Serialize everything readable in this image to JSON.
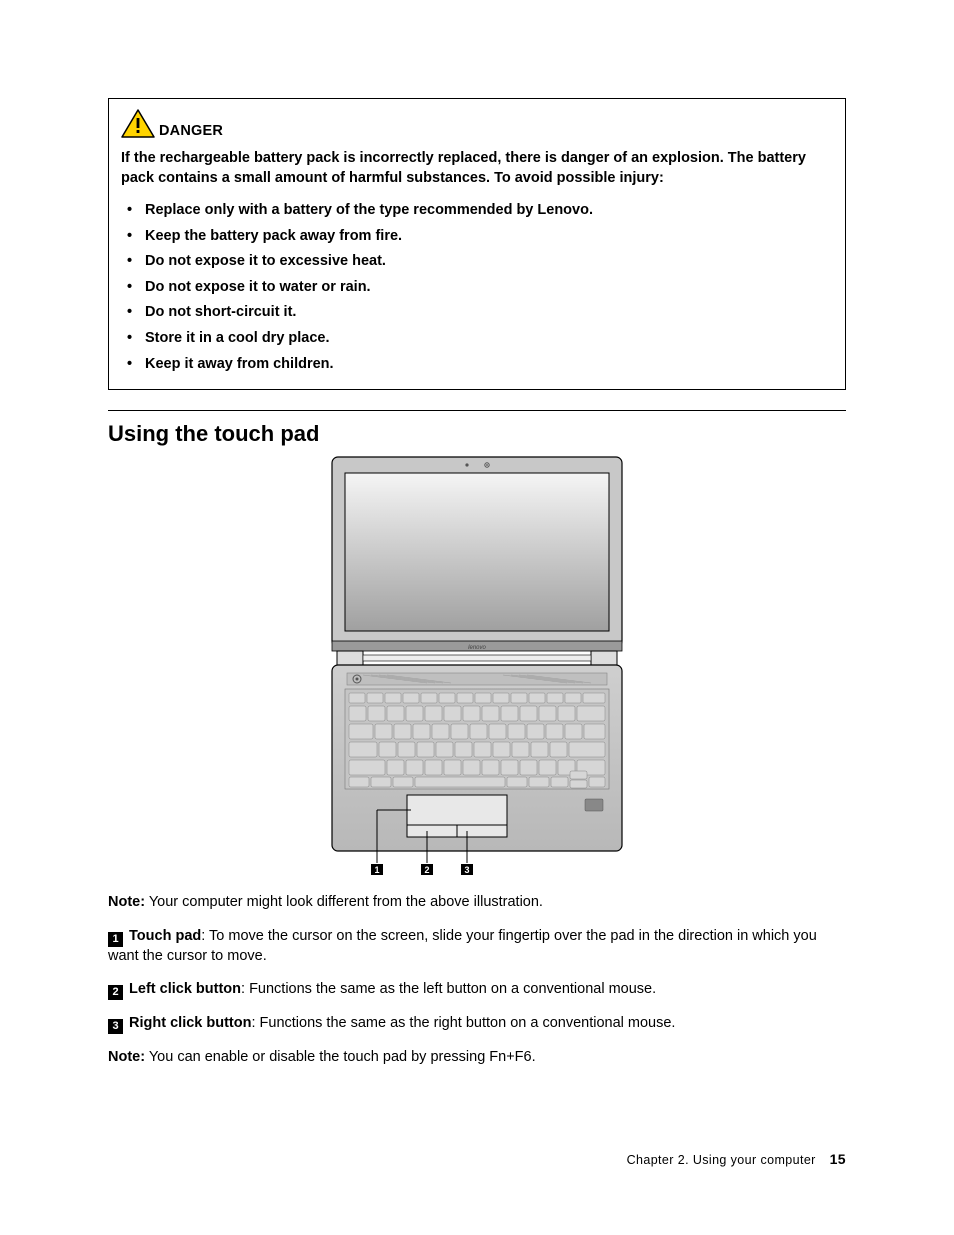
{
  "danger": {
    "label": "DANGER",
    "paragraph": "If the rechargeable battery pack is incorrectly replaced, there is danger of an explosion. The battery pack contains a small amount of harmful substances. To avoid possible injury:",
    "items": [
      "Replace only with a battery of the type recommended by Lenovo.",
      "Keep the battery pack away from fire.",
      "Do not expose it to excessive heat.",
      "Do not expose it to water or rain.",
      "Do not short-circuit it.",
      "Store it in a cool dry place.",
      "Keep it away from children."
    ]
  },
  "section_title": "Using the touch pad",
  "note1_label": "Note:",
  "note1_text": " Your computer might look different from the above illustration.",
  "callouts": [
    {
      "num": "1",
      "term": "Touch pad",
      "text": ": To move the cursor on the screen, slide your fingertip over the pad in the direction in which you want the cursor to move."
    },
    {
      "num": "2",
      "term": "Left click button",
      "text": ": Functions the same as the left button on a conventional mouse."
    },
    {
      "num": "3",
      "term": "Right click button",
      "text": ": Functions the same as the right button on a conventional mouse."
    }
  ],
  "note2_label": "Note:",
  "note2_text": " You can enable or disable the touch pad by pressing Fn+F6.",
  "illustration_labels": {
    "a": "1",
    "b": "2",
    "c": "3"
  },
  "footer": {
    "chapter": "Chapter 2.  Using your computer",
    "page": "15"
  }
}
